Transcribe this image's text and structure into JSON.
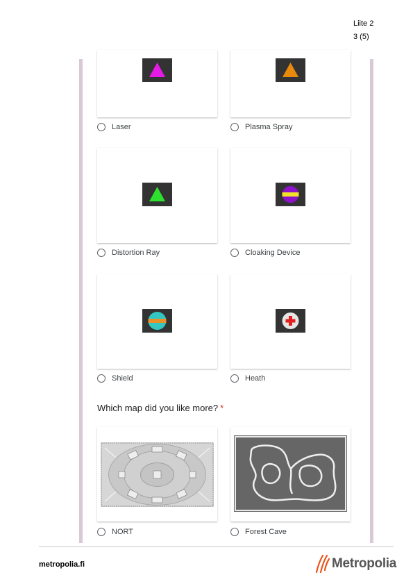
{
  "header": {
    "attachment": "Liite 2",
    "page": "3 (5)"
  },
  "options": [
    {
      "label": "Laser",
      "icon": "magenta-triangle-icon",
      "color": "#e61ae6"
    },
    {
      "label": "Plasma Spray",
      "icon": "orange-triangle-icon",
      "color": "#e88a0c"
    },
    {
      "label": "Distortion Ray",
      "icon": "green-triangle-icon",
      "color": "#2ee02e"
    },
    {
      "label": "Cloaking Device",
      "icon": "purple-yellow-orb-icon",
      "color": "#8e12c9"
    },
    {
      "label": "Shield",
      "icon": "teal-orange-orb-icon",
      "color": "#34c7c2"
    },
    {
      "label": "Heath",
      "icon": "red-cross-orb-icon",
      "color": "#e21f1f"
    }
  ],
  "question": {
    "text": "Which map did you like more?",
    "required_mark": "*"
  },
  "maps": [
    {
      "label": "NORT",
      "icon": "nort-map-thumbnail"
    },
    {
      "label": "Forest Cave",
      "icon": "forest-cave-map-thumbnail"
    }
  ],
  "footer": {
    "site": "metropolia.fi",
    "logo": "Metropolia"
  }
}
